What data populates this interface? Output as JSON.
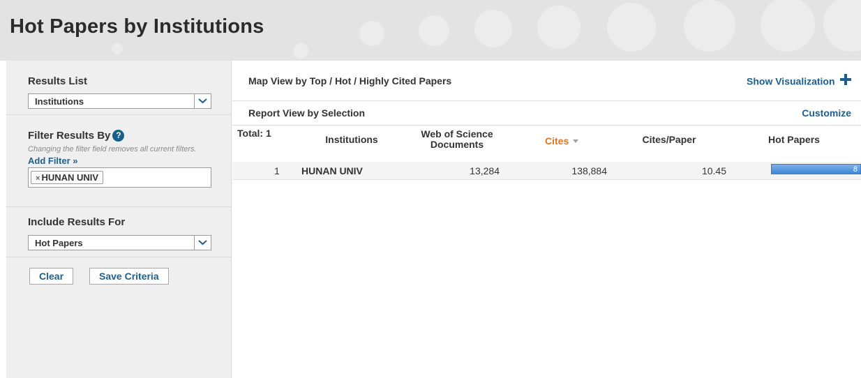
{
  "header": {
    "title": "Hot Papers by Institutions"
  },
  "sidebar": {
    "results_list": {
      "heading": "Results List",
      "selected": "Institutions"
    },
    "filter": {
      "heading": "Filter Results By",
      "hint": "Changing the filter field removes all current filters.",
      "add_filter_label": "Add Filter »",
      "chips": [
        {
          "label": "HUNAN UNIV"
        }
      ]
    },
    "include": {
      "heading": "Include Results For",
      "selected": "Hot Papers"
    },
    "buttons": {
      "clear": "Clear",
      "save": "Save Criteria"
    }
  },
  "main": {
    "map_view_label": "Map View by Top / Hot / Highly Cited Papers",
    "show_visualization_label": "Show Visualization",
    "report_view_label": "Report View by Selection",
    "customize_label": "Customize",
    "total_label": "Total: 1",
    "columns": {
      "institutions": "Institutions",
      "wos_documents": "Web of Science Documents",
      "cites": "Cites",
      "cites_per_paper": "Cites/Paper",
      "hot_papers": "Hot Papers"
    },
    "rows": [
      {
        "rank": "1",
        "institution": "HUNAN UNIV",
        "wos_documents": "13,284",
        "cites": "138,884",
        "cites_per_paper": "10.45",
        "hot_papers": "8"
      }
    ]
  },
  "colors": {
    "link_blue": "#1d5f8e",
    "sort_orange": "#e8731f",
    "bar_blue": "#4a8ad8"
  },
  "icons": {
    "help": "question-circle-icon",
    "sort": "sort-descending-icon",
    "plus": "plus-icon",
    "dropdown": "chevron-down-icon",
    "remove": "close-icon"
  }
}
